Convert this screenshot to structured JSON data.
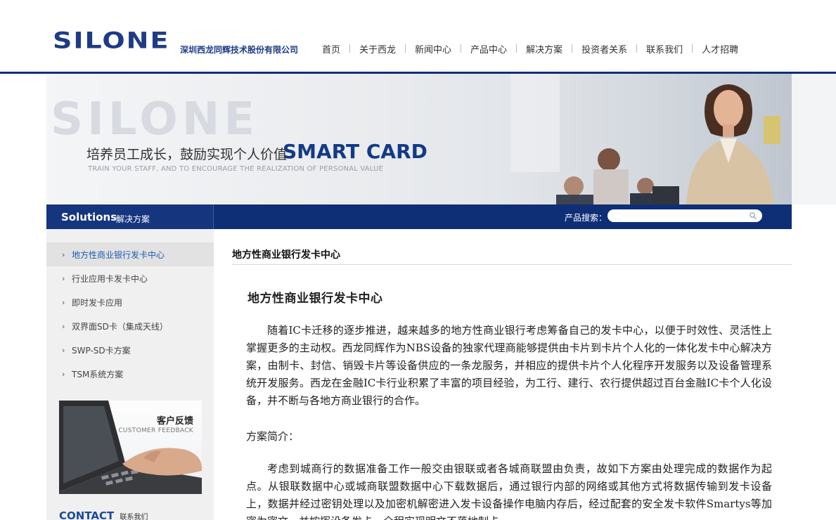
{
  "header": {
    "logo_text": "SILONE",
    "company_name": "深圳西龙同辉技术股份有限公司",
    "nav": [
      "首页",
      "关于西龙",
      "新闻中心",
      "产品中心",
      "解决方案",
      "投资者关系",
      "联系我们",
      "人才招聘"
    ]
  },
  "banner": {
    "watermark": "SILONE",
    "headline": "培养员工成长，鼓励实现个人价值",
    "headline_en": "SMART CARD",
    "subtitle": "TRAIN YOUR STAFF, AND TO ENCOURAGE THE REALIZATION OF PERSONAL VALUE"
  },
  "section_bar": {
    "title": "Solutions",
    "title_cn": "解决方案",
    "search_label": "产品搜索：",
    "search_value": ""
  },
  "sidebar": {
    "items": [
      {
        "label": "地方性商业银行发卡中心",
        "active": true
      },
      {
        "label": "行业应用卡发卡中心",
        "active": false
      },
      {
        "label": "即时发卡应用",
        "active": false
      },
      {
        "label": "双界面SD卡（集成天线）",
        "active": false
      },
      {
        "label": "SWP-SD卡方案",
        "active": false
      },
      {
        "label": "TSM系统方案",
        "active": false
      }
    ],
    "arrow": "›",
    "feedback_title": "客户反馈",
    "feedback_sub": "CUSTOMER FEEDBACK",
    "contact_title": "CONTACT",
    "contact_cn": "联系我们"
  },
  "main": {
    "heading": "地方性商业银行发卡中心",
    "article_title": "地方性商业银行发卡中心",
    "para1": "随着IC卡迁移的逐步推进，越来越多的地方性商业银行考虑筹备自己的发卡中心，以便于时效性、灵活性上掌握更多的主动权。西龙同辉作为NBS设备的独家代理商能够提供由卡片到卡片个人化的一体化发卡中心解决方案，由制卡、封信、销毁卡片等设备供应的一条龙服务，并相应的提供卡片个人化程序开发服务以及设备管理系统开发服务。西龙在金融IC卡行业积累了丰富的项目经验，为工行、建行、农行提供超过百台金融IC卡个人化设备，并不断与各地方商业银行的合作。",
    "intro_label": "方案简介：",
    "para2": "考虑到城商行的数据准备工作一般交由银联或者各城商联盟由负责，故如下方案由处理完成的数据作为起点。从银联数据中心或城商联盟数据中心下载数据后，通过银行内部的网络或其他方式将数据传输到发卡设备上，数据并经过密钥处理以及加密机解密进入发卡设备操作电脑内存后，经过配套的安全发卡软件Smartys等加密为密文，并按挥设备发卡，全程实现明文不落地制卡。"
  },
  "colors": {
    "brand_navy": "#0e2f76",
    "logo_blue": "#1d3b86",
    "active_link": "#1c5cb0"
  }
}
